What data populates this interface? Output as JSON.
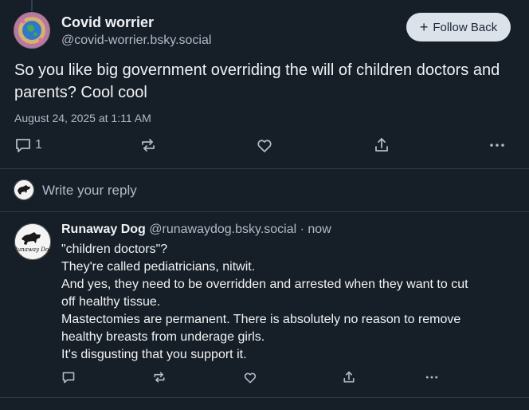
{
  "post": {
    "author_name": "Covid worrier",
    "author_handle": "@covid-worrier.bsky.social",
    "follow_label": "Follow Back",
    "text": "So you like big government overriding the will of children doctors and parents? Cool cool",
    "timestamp": "August 24, 2025 at 1:11 AM",
    "reply_count": "1",
    "icons": [
      "reply-icon",
      "repost-icon",
      "like-icon",
      "share-icon",
      "more-icon"
    ]
  },
  "composer": {
    "placeholder": "Write your reply"
  },
  "reply": {
    "author_name": "Runaway Dog",
    "author_handle": "@runawaydog.bsky.social",
    "separator": "·",
    "time": "now",
    "lines": [
      "\"children doctors\"?",
      "They're called pediatricians, nitwit.",
      "And yes, they need to be overridden and arrested when they want to cut",
      "off healthy tissue.",
      "Mastectomies are permanent. There is absolutely no reason to remove",
      "healthy breasts from underage girls.",
      "It's disgusting that you support it."
    ],
    "avatar_logo_text": "Runaway Dog"
  },
  "colors": {
    "background": "#161e27",
    "text": "#f1f3f5",
    "muted": "#aebbc9",
    "divider": "#2e3c4a",
    "follow_button_bg": "#dce2ea"
  }
}
